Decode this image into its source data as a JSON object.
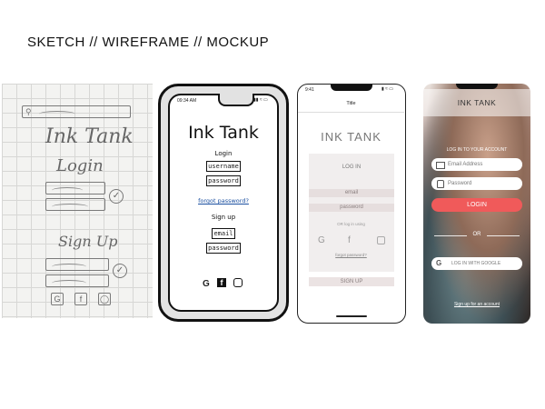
{
  "heading": "SKETCH // WIREFRAME // MOCKUP",
  "sketch": {
    "title": "Ink Tank",
    "login_label": "Login",
    "signup_label": "Sign Up",
    "icons": [
      "google-icon",
      "facebook-icon",
      "instagram-icon"
    ]
  },
  "wireframe": {
    "time": "09:34 AM",
    "title": "Ink Tank",
    "login_label": "Login",
    "username_field": "username",
    "password_field": "password",
    "forgot_link": "forgot password?",
    "signup_label": "Sign up",
    "email_field": "email",
    "signup_password_field": "password"
  },
  "mockup": {
    "time": "9:41",
    "nav_title": "Title",
    "brand": "INK TANK",
    "login_label": "LOG IN",
    "email_field": "email",
    "password_field": "password",
    "or_text": "OR log in using",
    "forgot_link": "forgot password?",
    "signup_button": "SIGN UP"
  },
  "photo_mockup": {
    "brand": "INK TANK",
    "subtitle": "LOG IN TO YOUR ACCOUNT",
    "email_placeholder": "Email Address",
    "password_placeholder": "Password",
    "login_button": "LOGIN",
    "or_text": "OR",
    "google_button": "LOG IN WITH GOOGLE",
    "signup_link": "Sign up for an account",
    "accent_color": "#f05a5a"
  }
}
